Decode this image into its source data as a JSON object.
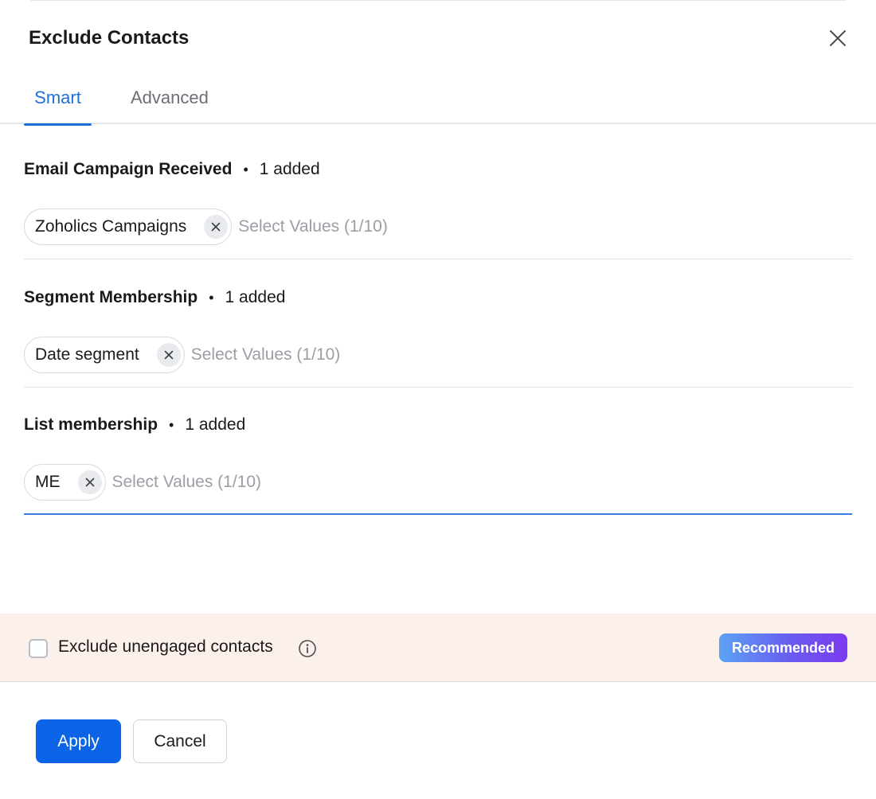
{
  "dialog": {
    "title": "Exclude Contacts",
    "close_icon": "close-icon"
  },
  "tabs": [
    {
      "label": "Smart",
      "active": true
    },
    {
      "label": "Advanced",
      "active": false
    }
  ],
  "sections": [
    {
      "title": "Email Campaign Received",
      "separator": "•",
      "count": "1 added",
      "chip": "Zoholics Campaigns",
      "placeholder": "Select Values (1/10)"
    },
    {
      "title": "Segment Membership",
      "separator": "•",
      "count": "1 added",
      "chip": "Date segment",
      "placeholder": "Select Values (1/10)"
    },
    {
      "title": "List membership",
      "separator": "•",
      "count": "1 added",
      "chip": "ME",
      "placeholder": "Select Values (1/10)"
    }
  ],
  "banner": {
    "checkbox_label": "Exclude unengaged contacts",
    "checked": false,
    "info_icon": "info-icon",
    "badge": "Recommended",
    "background_color": "#fbf1ea"
  },
  "footer": {
    "apply_label": "Apply",
    "cancel_label": "Cancel"
  },
  "colors": {
    "accent": "#1f6fd6",
    "primary_button": "#0b63e5"
  }
}
